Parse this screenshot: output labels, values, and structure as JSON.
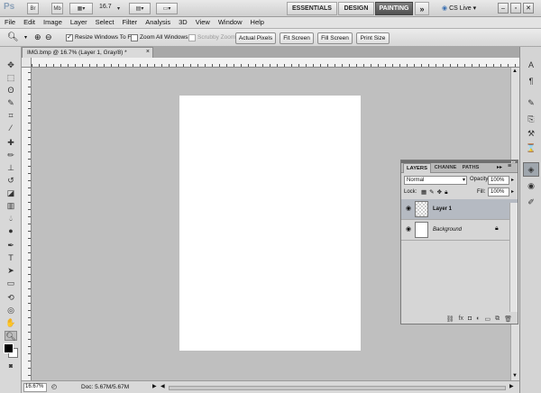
{
  "appbar": {
    "logo": "Ps",
    "mini_bridge": "Br",
    "mini_mb": "Mb",
    "zoom_level": "16.7",
    "workspaces": [
      "ESSENTIALS",
      "DESIGN",
      "PAINTING"
    ],
    "active_workspace": "PAINTING",
    "more": "»",
    "cs_live": "CS Live"
  },
  "menu": [
    "File",
    "Edit",
    "Image",
    "Layer",
    "Select",
    "Filter",
    "Analysis",
    "3D",
    "View",
    "Window",
    "Help"
  ],
  "options": {
    "resize_windows": "Resize Windows To Fit",
    "resize_checked": true,
    "zoom_all": "Zoom All Windows",
    "scrubby": "Scrubby Zoom",
    "buttons": [
      "Actual Pixels",
      "Fit Screen",
      "Fill Screen",
      "Print Size"
    ]
  },
  "document": {
    "tab_title": "IMG.bmp @ 16.7% (Layer 1, Gray/8) *",
    "close": "×"
  },
  "status": {
    "zoom": "16.67%",
    "doc_info": "Doc: 5.67M/5.67M"
  },
  "layers_panel": {
    "tabs": [
      "LAYERS",
      "CHANNE",
      "PATHS"
    ],
    "blend_mode": "Normal",
    "opacity_label": "Opacity:",
    "opacity_value": "100%",
    "lock_label": "Lock:",
    "fill_label": "Fill:",
    "fill_value": "100%",
    "layers": [
      {
        "name": "Layer 1",
        "selected": true
      },
      {
        "name": "Background",
        "selected": false
      }
    ]
  },
  "colors": {
    "foreground": "#000000",
    "background": "#ffffff",
    "active_workspace_bg": "#5a5a5a"
  }
}
